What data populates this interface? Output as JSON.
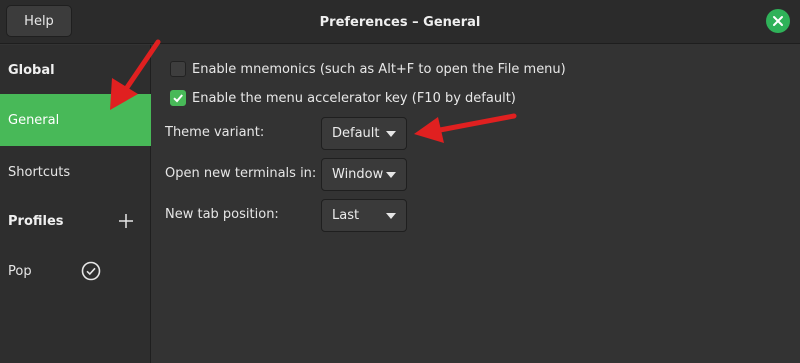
{
  "header": {
    "help_label": "Help",
    "title": "Preferences – General",
    "close_icon": "close-icon"
  },
  "sidebar": {
    "global_heading": "Global",
    "items": [
      {
        "label": "General",
        "active": true
      },
      {
        "label": "Shortcuts",
        "active": false
      }
    ],
    "profiles_heading": "Profiles",
    "add_icon": "plus-icon",
    "profiles": [
      {
        "label": "Pop",
        "icon": "check-circle-icon",
        "default": true
      }
    ]
  },
  "main": {
    "checkboxes": [
      {
        "label": "Enable mnemonics (such as Alt+F to open the File menu)",
        "checked": false
      },
      {
        "label": "Enable the menu accelerator key (F10 by default)",
        "checked": true
      }
    ],
    "fields": [
      {
        "label": "Theme variant:",
        "value": "Default"
      },
      {
        "label": "Open new terminals in:",
        "value": "Window"
      },
      {
        "label": "New tab position:",
        "value": "Last"
      }
    ]
  },
  "colors": {
    "accent": "#48b958",
    "close": "#2fb259",
    "annotation": "#e02020",
    "background": "#333333"
  }
}
